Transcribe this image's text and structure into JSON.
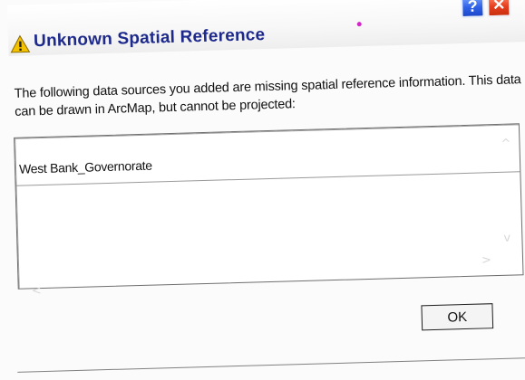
{
  "dialog": {
    "title": "Unknown Spatial Reference",
    "title_icon": "warning-triangle-icon",
    "title_color": "#1d2a8c",
    "help_label": "?",
    "close_label": "✕",
    "message": "The following data sources you added are missing spatial reference information. This data can be drawn in ArcMap, but cannot be projected:",
    "list": {
      "items": [
        "West Bank_Governorate"
      ]
    },
    "ok_label": "OK"
  },
  "colors": {
    "warning_yellow": "#f2c200",
    "help_blue": "#2f62e8",
    "close_red": "#e6401f"
  }
}
